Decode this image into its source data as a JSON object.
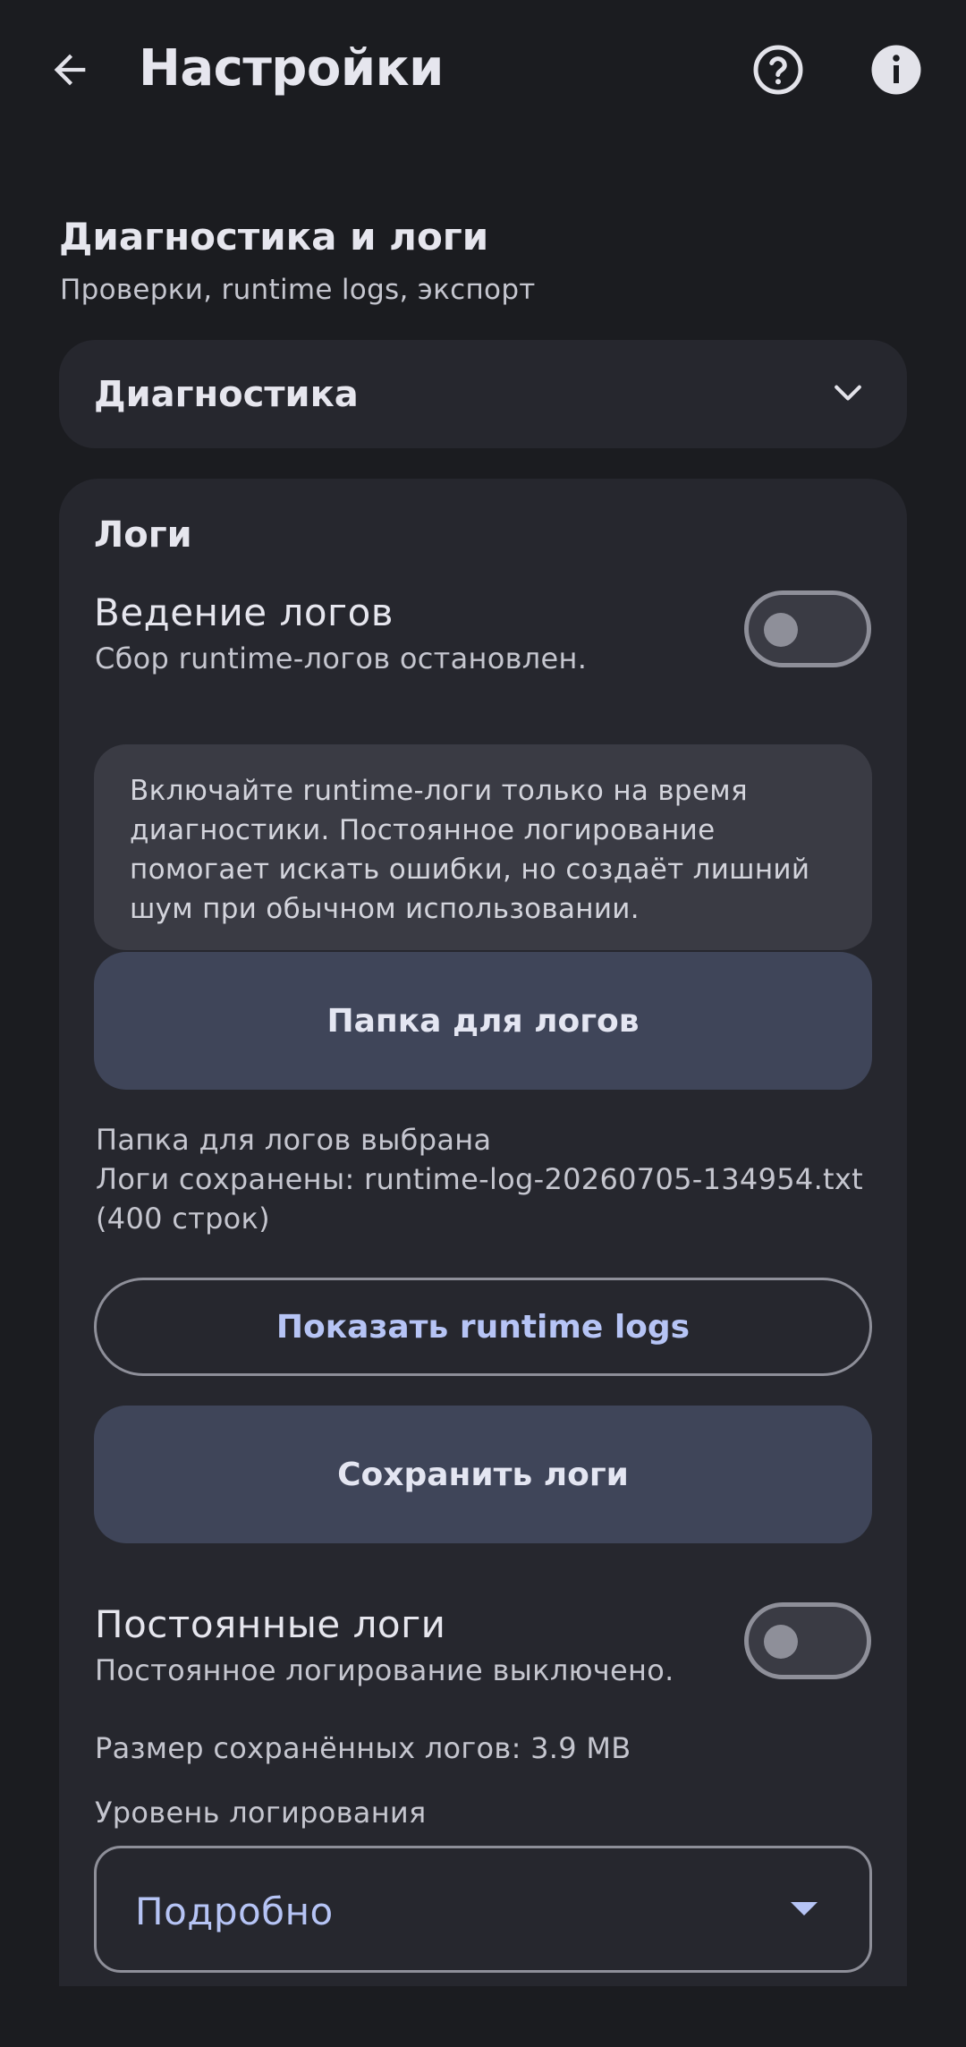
{
  "appbar": {
    "title": "Настройки",
    "back_icon": "arrow-back-icon",
    "help_icon": "help-circle-icon",
    "info_icon": "info-icon"
  },
  "section": {
    "title": "Диагностика и логи",
    "subtitle": "Проверки, runtime logs, экспорт"
  },
  "diagnostics_card": {
    "title": "Диагностика",
    "expand_icon": "chevron-down-icon"
  },
  "logs_card": {
    "title": "Логи",
    "logging": {
      "title": "Ведение логов",
      "status": "Сбор runtime-логов остановлен.",
      "enabled": false
    },
    "note": "Включайте runtime-логи только на время диагностики. Постоянное логирование помогает искать ошибки, но создаёт лишний шум при обычном использовании.",
    "folder_button": "Папка для логов",
    "folder_status": "Папка для логов выбрана",
    "saved_status": "Логи сохранены: runtime-log-20260705-134954.txt (400 строк)",
    "show_logs_button": "Показать runtime logs",
    "save_logs_button": "Сохранить логи",
    "persistent": {
      "title": "Постоянные логи",
      "status": "Постоянное логирование выключено.",
      "enabled": false
    },
    "saved_size": "Размер сохранённых логов: 3.9 MB",
    "level_label": "Уровень логирования",
    "level_value": "Подробно"
  },
  "colors": {
    "background": "#1b1c20",
    "card": "#26272e",
    "accent_text": "#b6c4f5",
    "tonal_button": "#3f4559"
  }
}
